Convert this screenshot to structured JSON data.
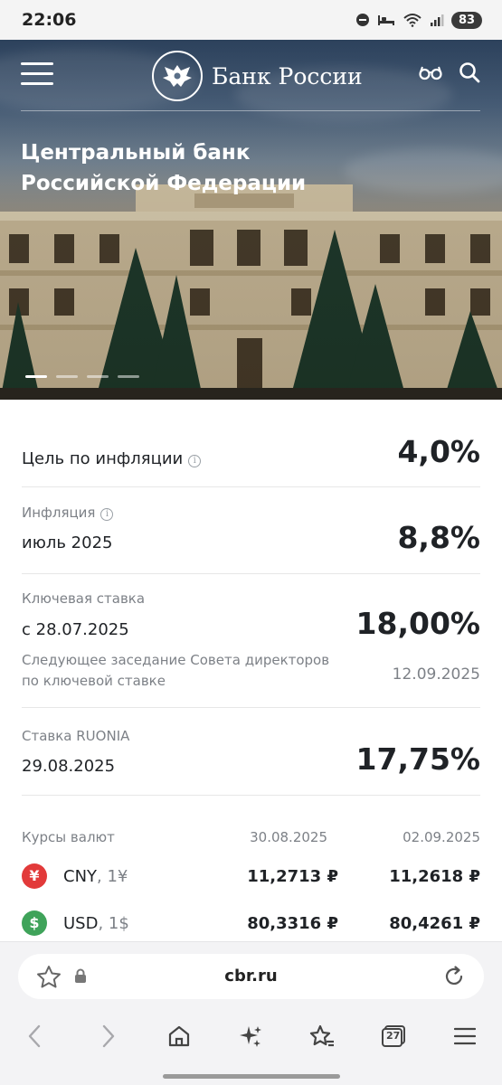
{
  "status_bar": {
    "time": "22:06",
    "battery": "83",
    "icons": [
      "do-not-disturb-icon",
      "sleep-icon",
      "wifi-icon",
      "signal-icon"
    ]
  },
  "header": {
    "logo_text": "Банк России",
    "menu_icon": "hamburger-menu-icon",
    "accessibility_icon": "glasses-icon",
    "search_icon": "search-icon"
  },
  "hero": {
    "title_line1": "Центральный банк",
    "title_line2": "Российской Федерации",
    "slides_count": 4,
    "active_slide": 1
  },
  "stats": {
    "inflation_target": {
      "label": "Цель по инфляции",
      "value": "4,0%"
    },
    "inflation": {
      "label": "Инфляция",
      "period": "июль 2025",
      "value": "8,8%"
    },
    "key_rate": {
      "label": "Ключевая ставка",
      "date": "с 28.07.2025",
      "value": "18,00%",
      "next_meeting_line1": "Следующее заседание Совета директоров",
      "next_meeting_line2": "по ключевой ставке",
      "next_meeting_date": "12.09.2025"
    },
    "ruonia": {
      "label": "Ставка RUONIA",
      "date": "29.08.2025",
      "value": "17,75%"
    }
  },
  "rates": {
    "title": "Курсы валют",
    "date1": "30.08.2025",
    "date2": "02.09.2025",
    "rows": [
      {
        "symbol": "¥",
        "code": "CNY",
        "unit": ", 1¥",
        "v1": "11,2713 ₽",
        "v2": "11,2618 ₽",
        "color": "#e23a3a"
      },
      {
        "symbol": "$",
        "code": "USD",
        "unit": ", 1$",
        "v1": "80,3316 ₽",
        "v2": "80,4261 ₽",
        "color": "#3fa35a"
      }
    ]
  },
  "browser": {
    "url": "cbr.ru",
    "tabs_count": "27"
  }
}
